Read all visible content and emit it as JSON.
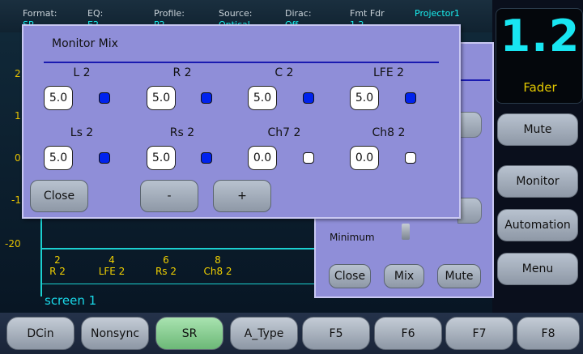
{
  "status_bar": {
    "items": [
      {
        "label": "Format:",
        "value": "SR"
      },
      {
        "label": "EQ:",
        "value": "E2"
      },
      {
        "label": "Profile:",
        "value": "P2"
      },
      {
        "label": "Source:",
        "value": "Optical"
      },
      {
        "label": "Dirac:",
        "value": "Off"
      },
      {
        "label": "Fmt Fdr",
        "value": "1.2"
      }
    ],
    "projector": "Projector1"
  },
  "meter": {
    "y_ticks": [
      "2",
      "1",
      "0",
      "-1",
      "-20"
    ],
    "channels": [
      {
        "num": "2",
        "name": "R 2"
      },
      {
        "num": "4",
        "name": "LFE 2"
      },
      {
        "num": "6",
        "name": "Rs 2"
      },
      {
        "num": "8",
        "name": "Ch8 2"
      }
    ],
    "screen_label": "screen 1"
  },
  "fader": {
    "value": "1.2",
    "label": "Fader"
  },
  "side_buttons": [
    "Mute",
    "Monitor",
    "Automation",
    "Menu"
  ],
  "bg_dialog": {
    "minimum_label": "Minimum",
    "buttons": [
      "Close",
      "Mix",
      "Mute"
    ]
  },
  "monitor_mix": {
    "title": "Monitor Mix",
    "channels": [
      {
        "label": "L 2",
        "value": "5.0",
        "on": true
      },
      {
        "label": "R 2",
        "value": "5.0",
        "on": true
      },
      {
        "label": "C 2",
        "value": "5.0",
        "on": true
      },
      {
        "label": "LFE 2",
        "value": "5.0",
        "on": true
      },
      {
        "label": "Ls 2",
        "value": "5.0",
        "on": true
      },
      {
        "label": "Rs 2",
        "value": "5.0",
        "on": true
      },
      {
        "label": "Ch7 2",
        "value": "0.0",
        "on": false
      },
      {
        "label": "Ch8 2",
        "value": "0.0",
        "on": false
      }
    ],
    "buttons": {
      "close": "Close",
      "minus": "-",
      "plus": "+"
    }
  },
  "function_keys": [
    {
      "label": "DCin",
      "active": false
    },
    {
      "label": "Nonsync",
      "active": false
    },
    {
      "label": "SR",
      "active": true
    },
    {
      "label": "A_Type",
      "active": false
    },
    {
      "label": "F5",
      "active": false
    },
    {
      "label": "F6",
      "active": false
    },
    {
      "label": "F7",
      "active": false
    },
    {
      "label": "F8",
      "active": false
    }
  ],
  "colors": {
    "led_on": "#0022ee",
    "led_off": "#ffffff"
  }
}
